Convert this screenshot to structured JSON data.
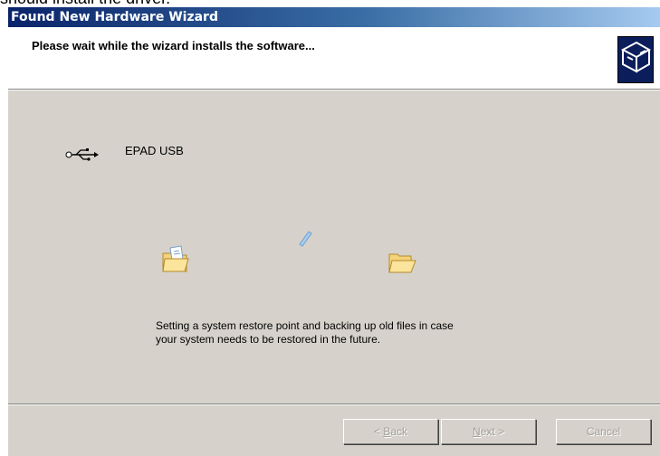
{
  "background_text": "should install the driver.",
  "window": {
    "title": "Found New Hardware Wizard"
  },
  "header": {
    "heading": "Please wait while the wizard installs the software...",
    "icon": "hardware-wizard-icon"
  },
  "device": {
    "icon": "usb-icon",
    "name": "EPAD USB"
  },
  "animation": {
    "source_icon": "folder-with-file-icon",
    "flying_icon": "flying-paper-icon",
    "target_icon": "open-folder-icon"
  },
  "status": {
    "line1": "Setting a system restore point and backing up old files in case",
    "line2": "your system needs to be restored in the future."
  },
  "buttons": {
    "back": {
      "prefix": "< ",
      "mnemonic": "B",
      "rest": "ack",
      "enabled": false
    },
    "next": {
      "mnemonic": "N",
      "rest": "ext",
      "suffix": " >",
      "enabled": false
    },
    "cancel": {
      "label": "Cancel",
      "enabled": false
    }
  },
  "colors": {
    "titlebar_start": "#0a246a",
    "titlebar_end": "#a6caf0",
    "dialog_bg": "#d6d2cb",
    "disabled_text": "#a39f98"
  }
}
